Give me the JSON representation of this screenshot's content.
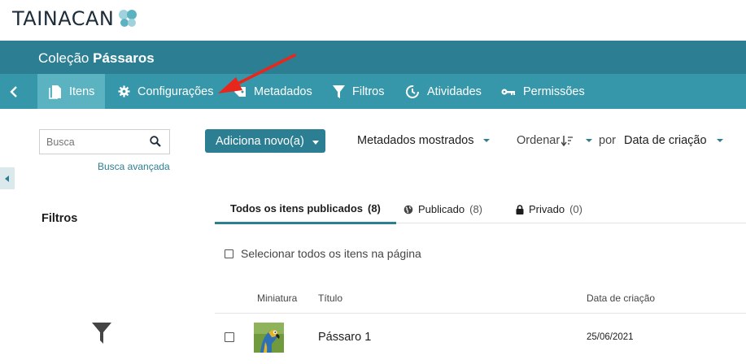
{
  "brand": {
    "logo_text": "TAINACAN"
  },
  "collection": {
    "prefix": "Coleção",
    "name": "Pássaros"
  },
  "nav": {
    "items": [
      {
        "label": "Itens",
        "icon": "items-icon",
        "active": true
      },
      {
        "label": "Configurações",
        "icon": "gear-icon"
      },
      {
        "label": "Metadados",
        "icon": "tag-icon"
      },
      {
        "label": "Filtros",
        "icon": "filter-icon"
      },
      {
        "label": "Atividades",
        "icon": "activity-icon"
      },
      {
        "label": "Permissões",
        "icon": "key-icon"
      }
    ]
  },
  "search": {
    "placeholder": "Busca",
    "advanced_label": "Busca avançada"
  },
  "filters": {
    "title": "Filtros"
  },
  "toolbar": {
    "add_label": "Adiciona novo(a)",
    "metadata_shown_label": "Metadados mostrados",
    "sort_label": "Ordenar",
    "by_label": "por",
    "sort_field": "Data de criação"
  },
  "tabs": [
    {
      "label": "Todos os itens publicados",
      "count": "(8)",
      "active": true
    },
    {
      "label": "Publicado",
      "count": "(8)",
      "icon": "globe-icon"
    },
    {
      "label": "Privado",
      "count": "(0)",
      "icon": "lock-icon"
    }
  ],
  "select_all_label": "Selecionar todos os itens na página",
  "table": {
    "headers": {
      "thumbnail": "Miniatura",
      "title": "Título",
      "created": "Data de criação"
    },
    "rows": [
      {
        "title": "Pássaro 1",
        "created": "25/06/2021",
        "thumbnail": "macaw-image"
      }
    ]
  },
  "colors": {
    "header_dark": "#2c7f92",
    "nav": "#3797aa",
    "nav_active": "#5bb2c1",
    "annotation": "#e8261c"
  }
}
